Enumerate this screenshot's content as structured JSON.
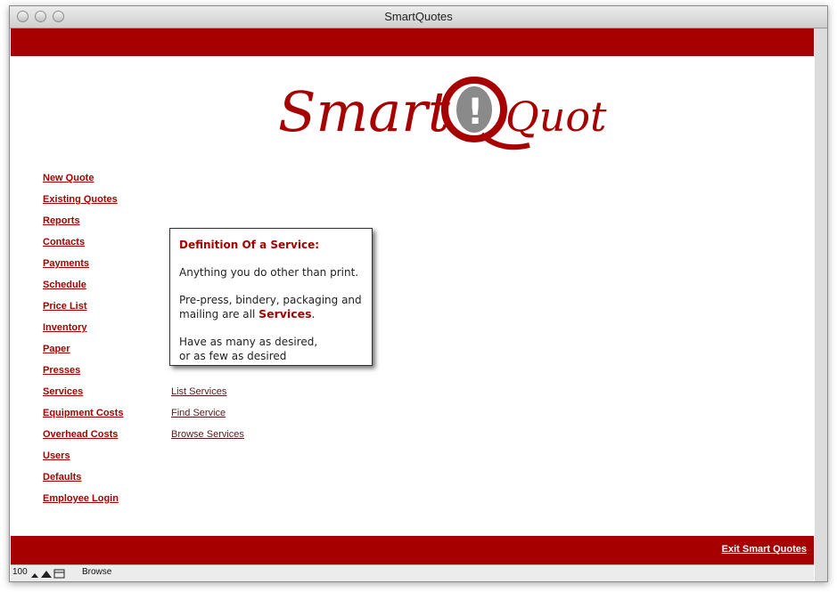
{
  "window": {
    "title": "SmartQuotes"
  },
  "logo": {
    "text_part1": "Smart",
    "text_part2": "Quotes",
    "mark": "!"
  },
  "nav": {
    "items": [
      "New Quote",
      "Existing Quotes",
      "Reports",
      "Contacts",
      "Payments",
      "Schedule",
      "Price List",
      "Inventory",
      "Paper",
      "Presses",
      "Services",
      "Equipment Costs",
      "Overhead Costs",
      "Users",
      "Defaults",
      "Employee Login"
    ]
  },
  "services_menu": {
    "items": [
      "List Services",
      "Find Service",
      "Browse Services"
    ]
  },
  "popup": {
    "heading": "Definition Of a Service:",
    "line1": "Anything you do other than print.",
    "line2a": "Pre-press, bindery, packaging and",
    "line2b": "mailing are all ",
    "line2_highlight": "Services",
    "line2_end": ".",
    "line3a": "Have as many as desired,",
    "line3b": "or as few as desired"
  },
  "footer": {
    "exit_label": "Exit Smart Quotes"
  },
  "status": {
    "zoom": "100",
    "mode": "Browse"
  },
  "colors": {
    "brand_red": "#a70000"
  }
}
